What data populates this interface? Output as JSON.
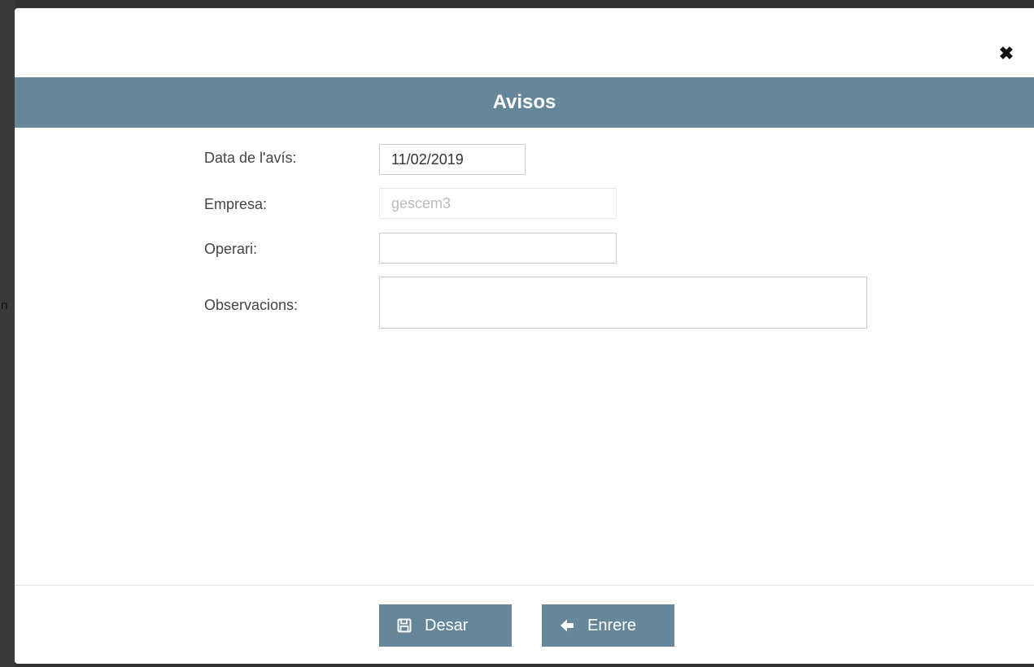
{
  "background": {
    "edge_letter": "n"
  },
  "modal": {
    "title": "Avisos",
    "close_glyph": "✖",
    "close_icon": "close-icon"
  },
  "form": {
    "fields": [
      {
        "label": "Data de l'avís:",
        "value": "11/02/2019",
        "disabled": false
      },
      {
        "label": "Empresa:",
        "value": "gescem3",
        "disabled": true
      },
      {
        "label": "Operari:",
        "value": "",
        "disabled": false
      },
      {
        "label": "Observacions:",
        "value": "",
        "disabled": false
      }
    ]
  },
  "footer": {
    "save_label": "Desar",
    "save_icon": "floppy-disk-icon",
    "back_label": "Enrere",
    "back_icon": "arrow-left-icon"
  },
  "colors": {
    "accent": "#66869a",
    "overlay": "#333333"
  }
}
